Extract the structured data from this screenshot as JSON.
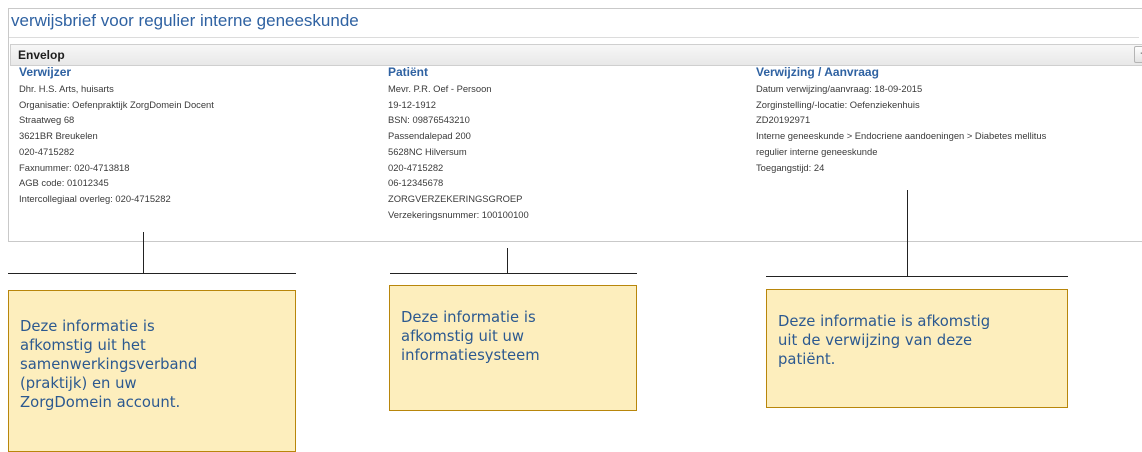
{
  "document": {
    "title": "verwijsbrief voor regulier interne geneeskunde"
  },
  "envelope": {
    "title": "Envelop",
    "collapse_symbol": "-"
  },
  "columns": [
    {
      "heading": "Verwijzer",
      "lines": [
        "Dhr. H.S. Arts, huisarts",
        "Organisatie: Oefenpraktijk ZorgDomein Docent",
        "Straatweg 68",
        "3621BR Breukelen",
        "020-4715282",
        "Faxnummer: 020-4713818",
        "AGB code: 01012345",
        "Intercollegiaal overleg: 020-4715282"
      ]
    },
    {
      "heading": "Patiënt",
      "lines": [
        "Mevr. P.R. Oef - Persoon",
        "19-12-1912",
        "BSN: 09876543210",
        "Passendalepad 200",
        "5628NC Hilversum",
        "020-4715282",
        "06-12345678",
        "ZORGVERZEKERINGSGROEP",
        "Verzekeringsnummer: 100100100"
      ]
    },
    {
      "heading": "Verwijzing / Aanvraag",
      "lines": [
        "Datum verwijzing/aanvraag: 18-09-2015",
        "Zorginstelling/-locatie: Oefenziekenhuis",
        "ZD20192971",
        "Interne geneeskunde > Endocriene aandoeningen > Diabetes mellitus",
        "regulier interne geneeskunde",
        "Toegangstijd: 24"
      ]
    }
  ],
  "annotations": [
    {
      "lines": [
        "Deze informatie is",
        "afkomstig uit het",
        "samenwerkingsverband",
        "(praktijk) en uw",
        "ZorgDomein account."
      ]
    },
    {
      "lines": [
        "Deze informatie is",
        "afkomstig uit uw",
        "informatiesysteem"
      ]
    },
    {
      "lines": [
        "Deze informatie is afkomstig",
        "uit de verwijzing van deze",
        "patiënt."
      ]
    }
  ],
  "colors": {
    "heading_blue": "#2f62a2",
    "note_fill": "#fdeebd",
    "note_border": "#b8860b",
    "note_text": "#2c5990"
  }
}
